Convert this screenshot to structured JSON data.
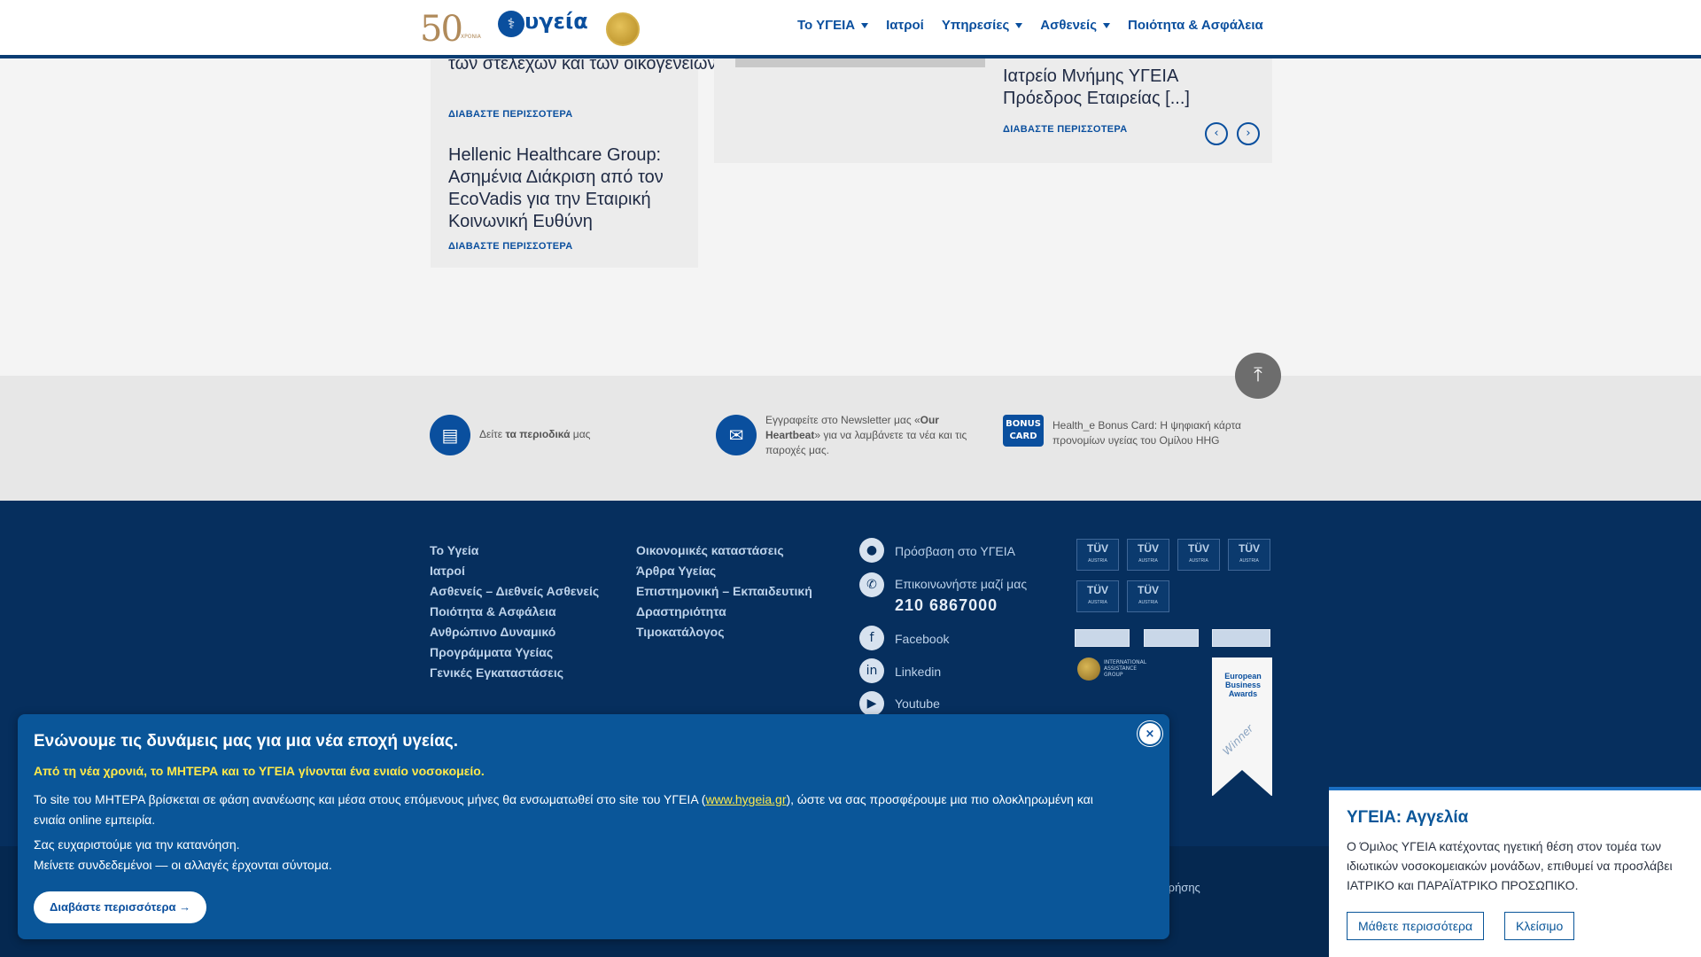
{
  "header": {
    "logo_50": "50",
    "logo_50_sub": "ΧΡΟΝΙΑ",
    "logo_hygeia": "υγεία",
    "nav": [
      {
        "label": "Το ΥΓΕΙΑ",
        "dropdown": true
      },
      {
        "label": "Ιατροί",
        "dropdown": false
      },
      {
        "label": "Υπηρεσίες",
        "dropdown": true
      },
      {
        "label": "Ασθενείς",
        "dropdown": true
      },
      {
        "label": "Ποιότητα & Ασφάλεια",
        "dropdown": false
      }
    ]
  },
  "news": {
    "left_items": [
      {
        "title": "των στελεχών και των οικογενειών τους",
        "read_more": "ΔΙΑΒΑΣΤΕ ΠΕΡΙΣΣΟΤΕΡΑ"
      },
      {
        "title": "Hellenic Healthcare Group: Ασημένια Διάκριση από τον EcoVadis για την Εταιρική Κοινωνική Ευθύνη",
        "read_more": "ΔΙΑΒΑΣΤΕ ΠΕΡΙΣΣΟΤΕΡΑ"
      }
    ],
    "right_item": {
      "title_line1": "Ιατρείο Μνήμης ΥΓΕΙΑ",
      "title_line2": "Πρόεδρος Εταιρείας [...]",
      "read_more": "ΔΙΑΒΑΣΤΕ ΠΕΡΙΣΣΟΤΕΡΑ"
    }
  },
  "info_strip": {
    "magazines_pre": "Δείτε",
    "magazines_bold": "τα περιοδικά",
    "magazines_post": "μας",
    "newsletter_pre": "Εγγραφείτε στο Newsletter μας «",
    "newsletter_bold": "Our Heartbeat",
    "newsletter_post": "» για να λαμβάνετε τα νέα και τις παροχές μας.",
    "bonus_icon": "BONUS CARD",
    "bonus_text": "Health_e Bonus Card: Η ψηφιακή κάρτα προνομίων υγείας του Ομίλου HHG"
  },
  "footer": {
    "col1": [
      "Το Υγεία",
      "Ιατροί",
      "Ασθενείς – Διεθνείς Ασθενείς",
      "Ποιότητα & Ασφάλεια",
      "Ανθρώπινο Δυναμικό",
      "Προγράμματα Υγείας",
      "Γενικές Εγκαταστάσεις"
    ],
    "col2": [
      "Οικονομικές καταστάσεις",
      "Άρθρα Υγείας",
      "Επιστημονική – Εκπαιδευτική",
      "Δραστηριότητα",
      "Τιμοκατάλογος"
    ],
    "contact": {
      "access": "Πρόσβαση στο ΥΓΕΙΑ",
      "contact_us": "Επικοινωνήστε μαζί μας",
      "phone": "210 6867000",
      "facebook": "Facebook",
      "linkedin": "Linkedin",
      "youtube": "Youtube"
    },
    "tuv_label": "TÜV",
    "tuv_sub": "AUSTRIA",
    "aig": "INTERNATIONAL ASSISTANCE GROUP",
    "eba": "European Business Awards",
    "eba_winner": "Winner",
    "copy_fragment": "Χρήσης"
  },
  "modal": {
    "title": "Ενώνουμε τις δυνάμεις μας για μια νέα εποχή υγείας.",
    "highlight": "Από τη νέα χρονιά, το ΜΗΤΕΡΑ και το ΥΓΕΙΑ γίνονται ένα ενιαίο νοσοκομείο.",
    "body_pre": "Το site του ΜΗΤΕΡΑ βρίσκεται σε φάση ανανέωσης και μέσα στους επόμενους μήνες θα ενσωματωθεί στο site του ΥΓΕΙΑ (",
    "body_link": "www.hygeia.gr",
    "body_post": "), ώστε να σας προσφέρουμε μια πιο ολοκληρωμένη και ενιαία online εμπειρία.",
    "thanks_1": "Σας ευχαριστούμε για την κατανόηση.",
    "thanks_2": "Μείνετε συνδεδεμένοι — οι αλλαγές έρχονται σύντομα.",
    "button": "Διαβάστε περισσότερα →",
    "close": "×"
  },
  "announcement": {
    "title": "ΥΓΕΙΑ: Αγγελία",
    "body": "Ο Όμιλος ΥΓΕΙΑ κατέχοντας ηγετική θέση στον τομέα των ιδιωτικών νοσοκομειακών μονάδων, επιθυμεί να προσλάβει ΙΑΤΡΙΚΟ και ΠΑΡΑΪΑΤΡΙΚΟ ΠΡΟΣΩΠΙΚΟ.",
    "learn_more": "Μάθετε περισσότερα",
    "close": "Κλείσιμο"
  },
  "colors": {
    "brand_blue": "#0a4f9e",
    "footer_navy": "#062f5e",
    "modal_blue": "#0a5699",
    "highlight_yellow": "#ffe94a"
  }
}
